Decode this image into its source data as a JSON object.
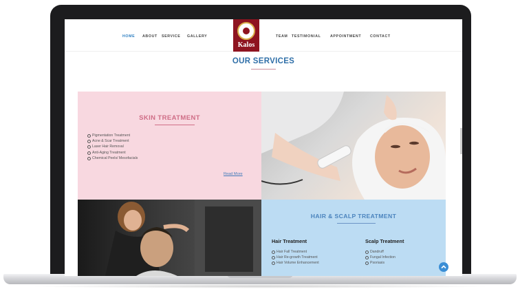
{
  "nav": {
    "items": [
      "HOME",
      "ABOUT",
      "SERVICE",
      "GALLERY",
      "TEAM",
      "TESTIMONIAL",
      "APPOINTMENT",
      "CONTACT"
    ],
    "active": "HOME",
    "logo_text": "Kalos"
  },
  "page": {
    "heading": "OUR SERVICES"
  },
  "skin": {
    "title": "SKIN TREATMENT",
    "items": [
      "Pigmentation Treatment",
      "Acne & Scar Treatment",
      "Laser Hair Removal",
      "Anti-Aging Treatment",
      "Chemical Peels/ Mesofacials"
    ],
    "read_more": "Read More"
  },
  "hair": {
    "title": "HAIR & SCALP TREATMENT",
    "hair_heading": "Hair Treatment",
    "hair_items": [
      "Hair Fall Treatment",
      "Hair Re-growth Treatment",
      "Hair Volume Enhancement"
    ],
    "scalp_heading": "Scalp Treatment",
    "scalp_items": [
      "Dandruff",
      "Fungal Infection",
      "Psoriasis"
    ]
  },
  "colors": {
    "nav_active": "#2b7ec1",
    "heading": "#2f6fa8",
    "skin_bg": "#f8d8e0",
    "skin_title": "#cf6d86",
    "hair_bg": "#bcdcf3",
    "logo_bg": "#8e1420",
    "scroll_top": "#3a8ed6"
  },
  "icons": [
    "bullet-circle-icon",
    "chevron-up-icon"
  ]
}
